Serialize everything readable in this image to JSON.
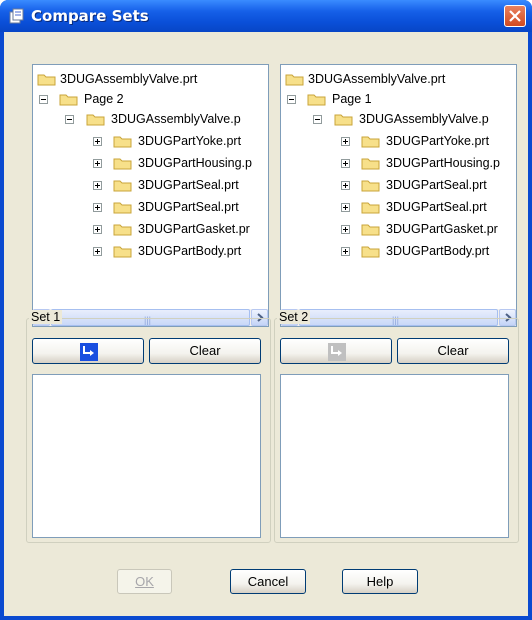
{
  "window": {
    "title": "Compare Sets"
  },
  "left_tree": {
    "root": "3DUGAssemblyValve.prt",
    "page": "Page 2",
    "assembly": "3DUGAssemblyValve.p",
    "parts": [
      "3DUGPartYoke.prt",
      "3DUGPartHousing.p",
      "3DUGPartSeal.prt",
      "3DUGPartSeal.prt",
      "3DUGPartGasket.pr",
      "3DUGPartBody.prt"
    ]
  },
  "right_tree": {
    "root": "3DUGAssemblyValve.prt",
    "page": "Page 1",
    "assembly": "3DUGAssemblyValve.p",
    "parts": [
      "3DUGPartYoke.prt",
      "3DUGPartHousing.p",
      "3DUGPartSeal.prt",
      "3DUGPartSeal.prt",
      "3DUGPartGasket.pr",
      "3DUGPartBody.prt"
    ]
  },
  "set1": {
    "label": "Set 1",
    "add_icon": "add-to-set-icon",
    "clear_label": "Clear"
  },
  "set2": {
    "label": "Set 2",
    "add_icon": "add-to-set-icon",
    "clear_label": "Clear"
  },
  "footer": {
    "ok_label": "OK",
    "cancel_label": "Cancel",
    "help_label": "Help"
  },
  "colors": {
    "title_bar": "#0a4fd8",
    "dialog_bg": "#ece9d8",
    "close_button": "#d24a20",
    "add_active": "#1a4fe0",
    "add_disabled": "#c0c0c0"
  }
}
